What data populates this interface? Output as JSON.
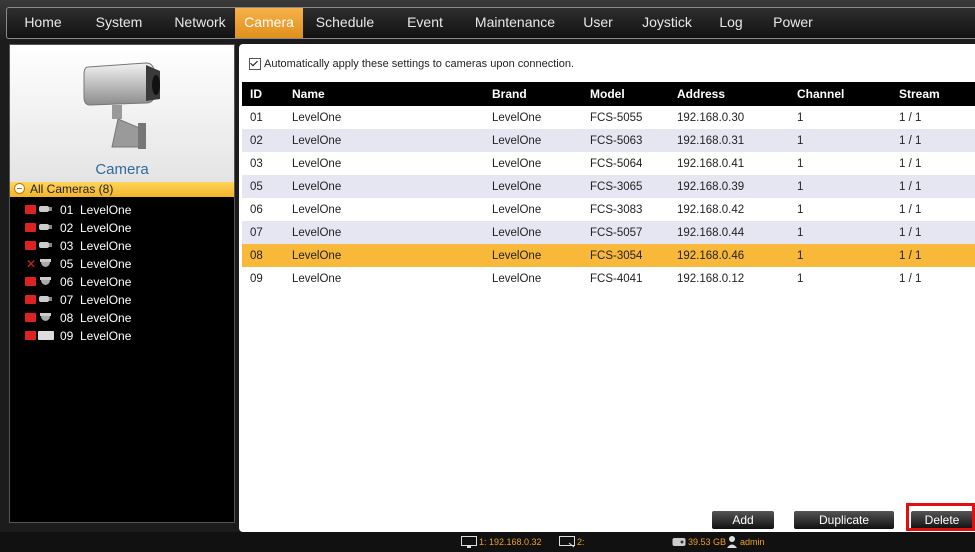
{
  "menu": {
    "items": [
      {
        "label": "Home",
        "active": false
      },
      {
        "label": "System",
        "active": false
      },
      {
        "label": "Network",
        "active": false
      },
      {
        "label": "Camera",
        "active": true
      },
      {
        "label": "Schedule",
        "active": false
      },
      {
        "label": "Event",
        "active": false
      },
      {
        "label": "Maintenance",
        "active": false
      },
      {
        "label": "User",
        "active": false
      },
      {
        "label": "Joystick",
        "active": false
      },
      {
        "label": "Log",
        "active": false
      },
      {
        "label": "Power",
        "active": false
      }
    ]
  },
  "sidebar": {
    "title": "Camera",
    "group_label": "All Cameras (8)",
    "cameras": [
      {
        "id": "01",
        "name": "LevelOne",
        "icon": "bullet-camera-icon",
        "status": "rec"
      },
      {
        "id": "02",
        "name": "LevelOne",
        "icon": "bullet-camera-icon",
        "status": "rec"
      },
      {
        "id": "03",
        "name": "LevelOne",
        "icon": "bullet-camera-icon",
        "status": "rec"
      },
      {
        "id": "05",
        "name": "LevelOne",
        "icon": "dome-camera-icon",
        "status": "disconnected"
      },
      {
        "id": "06",
        "name": "LevelOne",
        "icon": "dome-camera-icon",
        "status": "rec"
      },
      {
        "id": "07",
        "name": "LevelOne",
        "icon": "bullet-camera-icon",
        "status": "rec"
      },
      {
        "id": "08",
        "name": "LevelOne",
        "icon": "dome-camera-icon",
        "status": "rec"
      },
      {
        "id": "09",
        "name": "LevelOne",
        "icon": "onvif-icon",
        "status": "rec"
      }
    ]
  },
  "main": {
    "auto_apply_label": "Automatically apply these settings to cameras upon connection.",
    "auto_apply_checked": true,
    "columns": [
      "ID",
      "Name",
      "Brand",
      "Model",
      "Address",
      "Channel",
      "Stream"
    ],
    "rows": [
      [
        "01",
        "LevelOne",
        "LevelOne",
        "FCS-5055",
        "192.168.0.30",
        "1",
        "1 / 1"
      ],
      [
        "02",
        "LevelOne",
        "LevelOne",
        "FCS-5063",
        "192.168.0.31",
        "1",
        "1 / 1"
      ],
      [
        "03",
        "LevelOne",
        "LevelOne",
        "FCS-5064",
        "192.168.0.41",
        "1",
        "1 / 1"
      ],
      [
        "05",
        "LevelOne",
        "LevelOne",
        "FCS-3065",
        "192.168.0.39",
        "1",
        "1 / 1"
      ],
      [
        "06",
        "LevelOne",
        "LevelOne",
        "FCS-3083",
        "192.168.0.42",
        "1",
        "1 / 1"
      ],
      [
        "07",
        "LevelOne",
        "LevelOne",
        "FCS-5057",
        "192.168.0.44",
        "1",
        "1 / 1"
      ],
      [
        "08",
        "LevelOne",
        "LevelOne",
        "FCS-3054",
        "192.168.0.46",
        "1",
        "1 / 1"
      ],
      [
        "09",
        "LevelOne",
        "LevelOne",
        "FCS-4041",
        "192.168.0.12",
        "1",
        "1 / 1"
      ]
    ],
    "selected_row_index": 6,
    "buttons": {
      "add": "Add",
      "duplicate": "Duplicate",
      "delete": "Delete"
    }
  },
  "statusbar": {
    "monitor1": "1: 192.168.0.32",
    "monitor2": "2:",
    "storage": "39.53 GB",
    "user": "admin"
  },
  "colors": {
    "accent_orange": "#f8b83a",
    "row_alt": "#e6e6f3",
    "camera_label": "#2f6b9b",
    "highlight_red": "#e01010"
  }
}
